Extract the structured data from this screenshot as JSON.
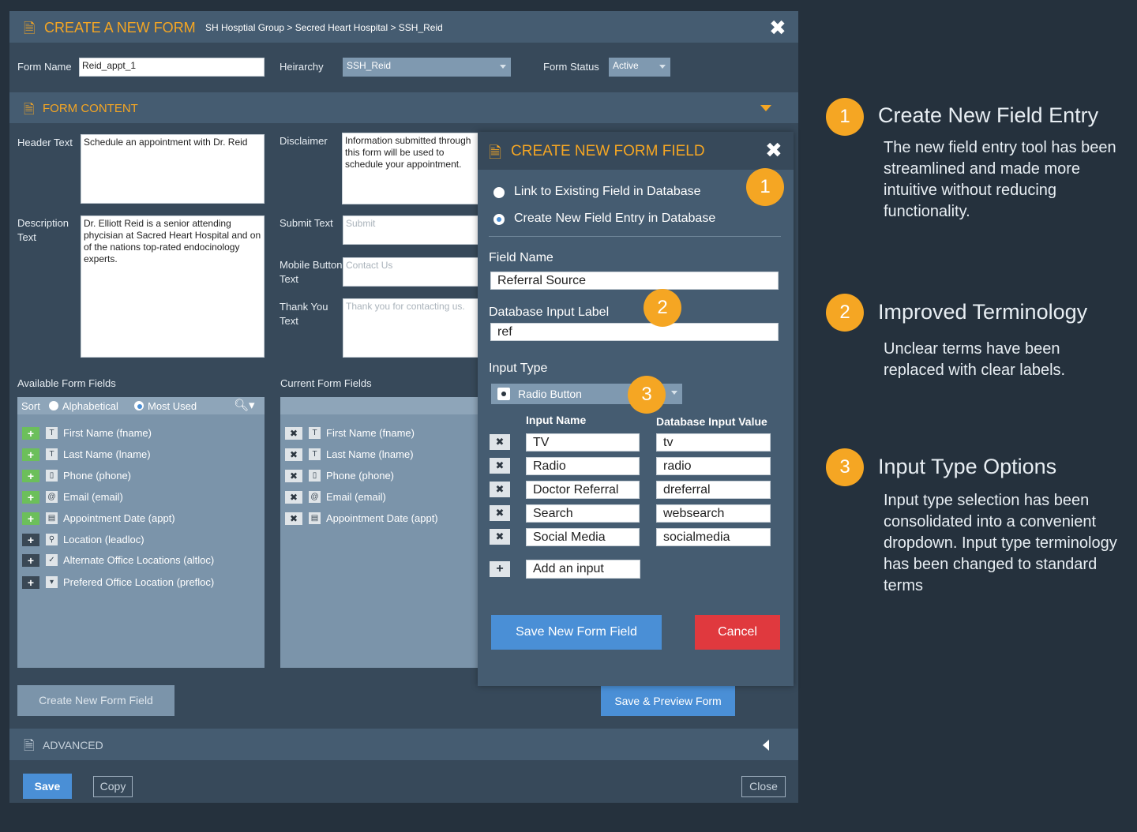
{
  "form": {
    "title": "CREATE A NEW FORM",
    "breadcrumb": "SH Hosptial Group > Secred Heart Hospital > SSH_Reid",
    "form_name_label": "Form Name",
    "form_name_value": "Reid_appt_1",
    "hierarchy_label": "Heirarchy",
    "hierarchy_value": "SSH_Reid",
    "status_label": "Form Status",
    "status_value": "Active"
  },
  "content": {
    "title": "FORM CONTENT",
    "header_text_label": "Header Text",
    "header_text_value": "Schedule an appointment with Dr. Reid",
    "description_label": "Description Text",
    "description_value": "Dr. Elliott Reid is a senior attending phycisian at Sacred Heart Hospital and on of the nations top-rated endocinology experts.",
    "disclaimer_label": "Disclaimer",
    "disclaimer_value": "Information submitted through this form will be used to schedule your appointment.",
    "submit_label": "Submit Text",
    "submit_placeholder": "Submit",
    "mobile_label": "Mobile Button Text",
    "mobile_placeholder": "Contact Us",
    "thankyou_label": "Thank You Text",
    "thankyou_placeholder": "Thank you for contacting us."
  },
  "available": {
    "title": "Available Form Fields",
    "sort_label": "Sort",
    "sort_alpha": "Alphabetical",
    "sort_most": "Most Used",
    "items": [
      {
        "label": "First Name (fname)",
        "icon": "T"
      },
      {
        "label": "Last Name (lname)",
        "icon": "T"
      },
      {
        "label": "Phone (phone)",
        "icon": "▯"
      },
      {
        "label": "Email (email)",
        "icon": "@"
      },
      {
        "label": "Appointment Date (appt)",
        "icon": "▤"
      },
      {
        "label": "Location (leadloc)",
        "icon": "⚲"
      },
      {
        "label": "Alternate Office Locations (altloc)",
        "icon": "✓"
      },
      {
        "label": "Prefered Office Location (prefloc)",
        "icon": "▾"
      }
    ]
  },
  "current": {
    "title": "Current Form Fields",
    "items": [
      {
        "label": "First Name (fname)",
        "icon": "T"
      },
      {
        "label": "Last Name (lname)",
        "icon": "T"
      },
      {
        "label": "Phone (phone)",
        "icon": "▯"
      },
      {
        "label": "Email (email)",
        "icon": "@"
      },
      {
        "label": "Appointment Date (appt)",
        "icon": "▤"
      }
    ]
  },
  "buttons": {
    "create_field": "Create New Form Field",
    "save_preview": "Save & Preview Form",
    "save": "Save",
    "copy": "Copy",
    "close": "Close"
  },
  "advanced": {
    "title": "ADVANCED"
  },
  "modal": {
    "title": "CREATE NEW FORM FIELD",
    "opt_link": "Link to Existing Field in Database",
    "opt_create": "Create New Field Entry in Database",
    "field_name_label": "Field Name",
    "field_name_value": "Referral Source",
    "db_label_label": "Database Input Label",
    "db_label_value": "ref",
    "input_type_label": "Input Type",
    "input_type_value": "Radio Button",
    "col_name": "Input Name",
    "col_value": "Database Input Value",
    "inputs": [
      {
        "name": "TV",
        "value": "tv"
      },
      {
        "name": "Radio",
        "value": "radio"
      },
      {
        "name": "Doctor Referral",
        "value": "dreferral"
      },
      {
        "name": "Search",
        "value": "websearch"
      },
      {
        "name": "Social Media",
        "value": "socialmedia"
      }
    ],
    "add_input": "Add an input",
    "save_btn": "Save New Form Field",
    "cancel_btn": "Cancel"
  },
  "badges": [
    "1",
    "2",
    "3"
  ],
  "notes": [
    {
      "num": "1",
      "title": "Create New Field Entry",
      "body": "The new field entry tool has been streamlined and made more intuitive without reducing functionality."
    },
    {
      "num": "2",
      "title": "Improved Terminology",
      "body": "Unclear terms have been replaced with clear labels."
    },
    {
      "num": "3",
      "title": "Input Type Options",
      "body": "Input type selection has been consolidated into a convenient dropdown. Input type terminology has been changed to standard terms"
    }
  ],
  "colors": {
    "accent": "#f5a623",
    "primary_button": "#4a8fd6",
    "cancel_button": "#e0393e",
    "background": "#25313d"
  }
}
